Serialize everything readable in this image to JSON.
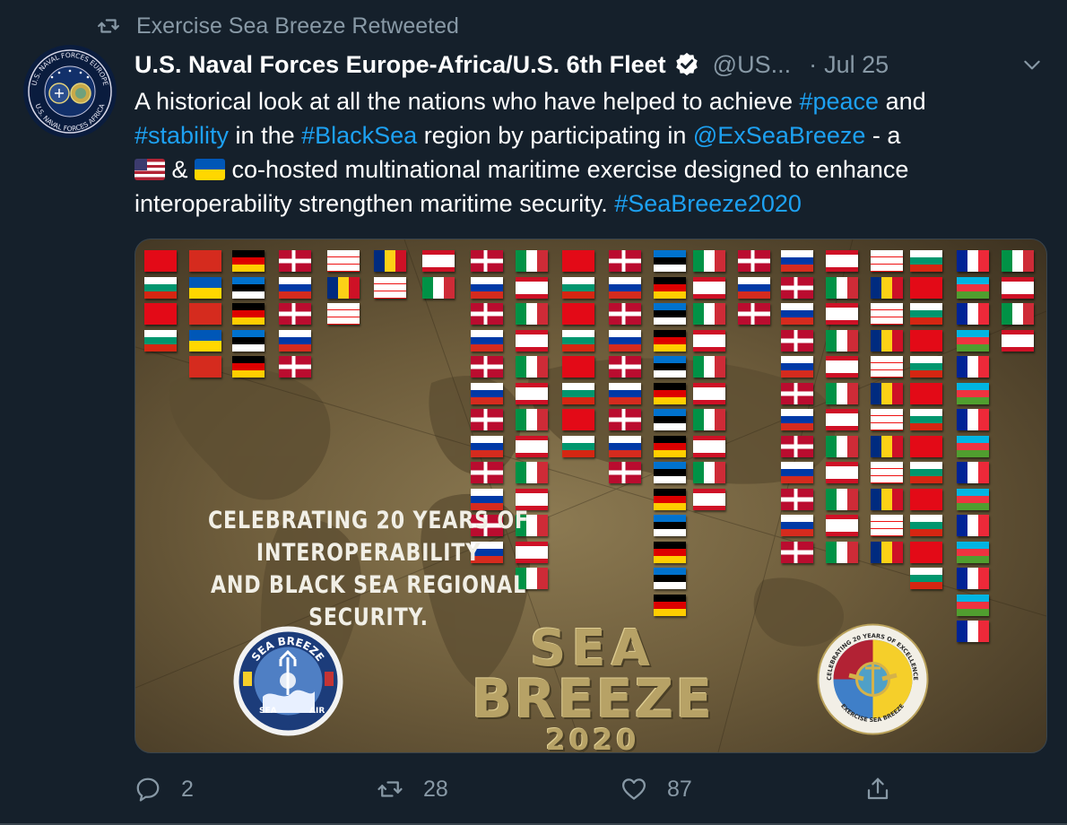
{
  "retweet_notice": {
    "text": "Exercise Sea Breeze Retweeted",
    "icon": "retweet-icon"
  },
  "author": {
    "avatar_icon": "us-naval-forces-europe-africa-seal",
    "avatar_ring_top": "U.S. NAVAL FORCES EUROPE",
    "avatar_ring_bottom": "U.S. NAVAL FORCES AFRICA",
    "name": "U.S. Naval Forces Europe-Africa/U.S. 6th Fleet",
    "verified": true,
    "handle": "@US...",
    "separator": "·",
    "date": "Jul 25"
  },
  "tweet": {
    "line1": {
      "a": "A historical look at all the nations who have helped to achieve ",
      "h1": "#peace",
      "b": " and"
    },
    "line2": {
      "h2": "#stability",
      "c": " in the ",
      "h3": "#BlackSea",
      "d": " region by participating in ",
      "m1": "@ExSeaBreeze",
      "e": " - a"
    },
    "line3": {
      "f": " & ",
      "g": " co-hosted multinational maritime exercise designed to enhance"
    },
    "line4": {
      "h": "interoperability strengthen maritime security. ",
      "h4": "#SeaBreeze2020"
    },
    "flag_1": "flag-us-icon",
    "flag_2": "flag-ukraine-icon"
  },
  "media": {
    "caption_1": "CELEBRATING 20 YEARS OF",
    "caption_2": "INTEROPERABILITY",
    "caption_3": "AND BLACK SEA REGIONAL SECURITY.",
    "logo_1": "SEA",
    "logo_2": "BREEZE",
    "logo_3": "2020",
    "seal_left_top": "SEA BREEZE",
    "seal_left_sea": "SEA",
    "seal_left_land": "LAND",
    "seal_left_air": "AIR",
    "seal_right_top": "CELEBRATING 20 YEARS OF EXCELLENCE",
    "seal_right_bottom": "EXERCISE SEA BREEZE"
  },
  "actions": {
    "reply": {
      "icon": "reply-icon",
      "count": "2"
    },
    "retweet": {
      "icon": "retweet-icon",
      "count": "28"
    },
    "like": {
      "icon": "heart-icon",
      "count": "87"
    },
    "share": {
      "icon": "share-icon"
    }
  },
  "colors": {
    "background": "#15202b",
    "link": "#1da1f2",
    "muted": "#8899a6",
    "divider": "#38444d"
  }
}
